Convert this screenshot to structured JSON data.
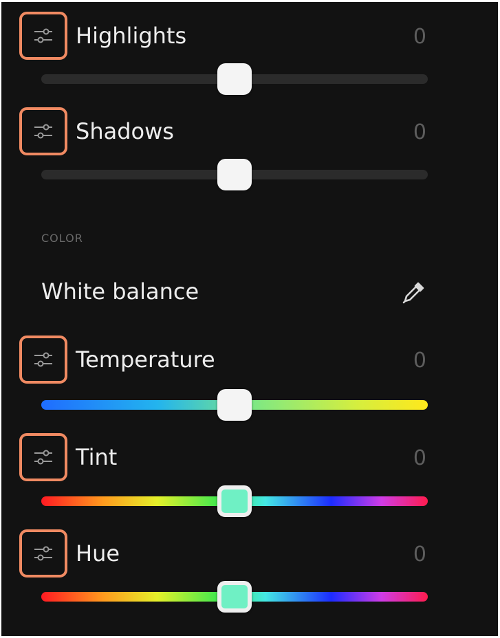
{
  "adjustments": [
    {
      "label": "Highlights",
      "value": "0",
      "slider_position": 0.5
    },
    {
      "label": "Shadows",
      "value": "0",
      "slider_position": 0.5
    }
  ],
  "color_section": {
    "title": "COLOR",
    "white_balance_label": "White balance",
    "picker_icon": "eyedropper-icon"
  },
  "color_adjustments": [
    {
      "label": "Temperature",
      "value": "0",
      "slider_position": 0.5,
      "thumb_color": "#f4f4f4"
    },
    {
      "label": "Tint",
      "value": "0",
      "slider_position": 0.5,
      "thumb_color": "#6ff0c4"
    },
    {
      "label": "Hue",
      "value": "0",
      "slider_position": 0.5,
      "thumb_color": "#6ff0c4"
    }
  ],
  "colors": {
    "panel_background": "#121212",
    "icon_highlight": "#f08a62",
    "text": "#ededed",
    "value_text": "#5d5d5d"
  }
}
